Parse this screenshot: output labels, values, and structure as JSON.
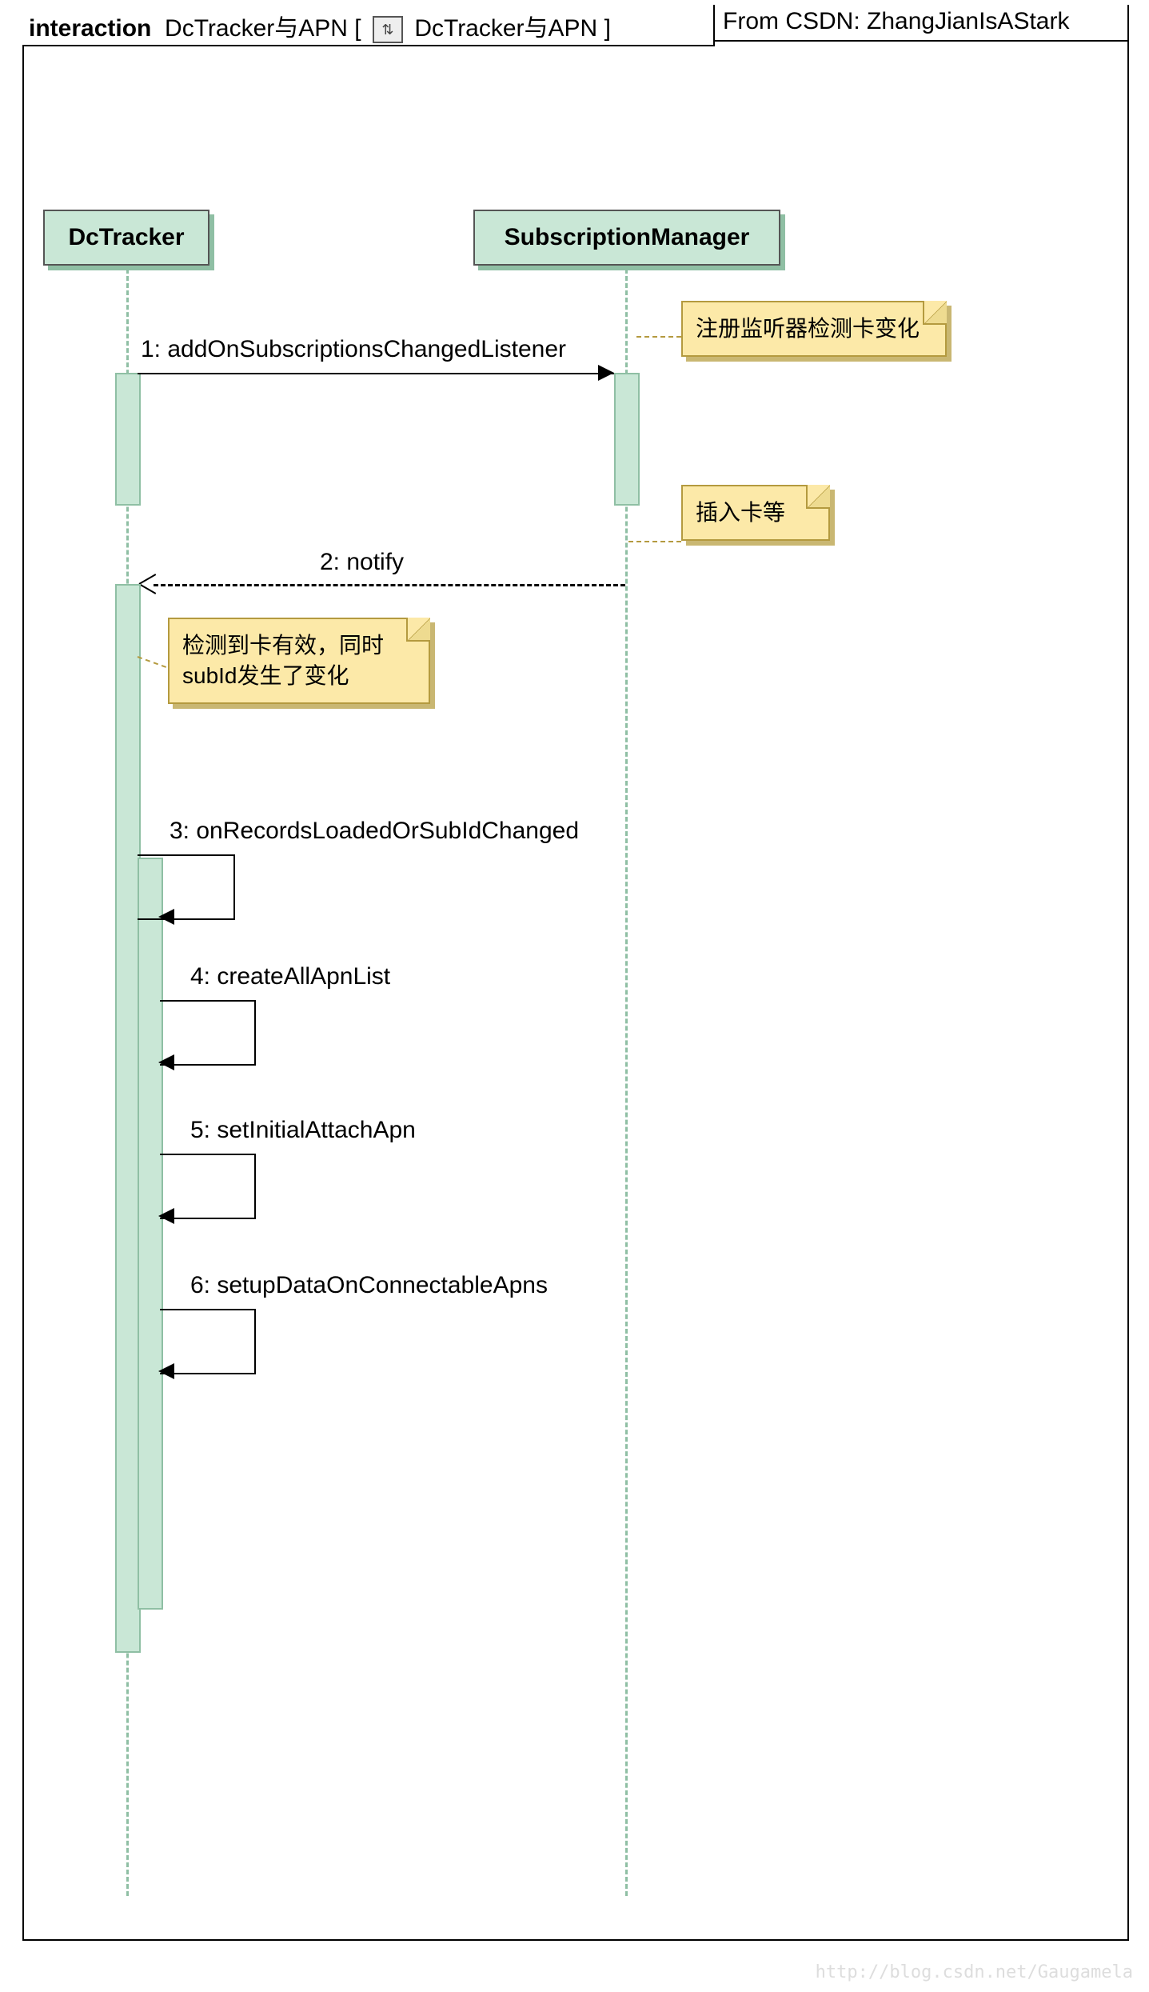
{
  "header": {
    "prefix": "interaction",
    "title": "DcTracker与APN",
    "inner_title": "DcTracker与APN",
    "reference": "From CSDN: ZhangJianIsAStark"
  },
  "lifelines": {
    "a": "DcTracker",
    "b": "SubscriptionManager"
  },
  "messages": {
    "m1": "1: addOnSubscriptionsChangedListener",
    "m2": "2: notify",
    "m3": "3: onRecordsLoadedOrSubIdChanged",
    "m4": "4: createAllApnList",
    "m5": "5: setInitialAttachApn",
    "m6": "6: setupDataOnConnectableApns"
  },
  "notes": {
    "n1": "注册监听器检测卡变化",
    "n2": "插入卡等",
    "n3": "检测到卡有效，同时subId发生了变化"
  },
  "watermark": "http://blog.csdn.net/Gaugamela",
  "colors": {
    "lifeline_fill": "#c9e7d6",
    "lifeline_border": "#8fbfa4",
    "note_fill": "#fce9a8",
    "note_border": "#b49a3f"
  },
  "chart_data": {
    "type": "sequence_diagram",
    "title": "interaction DcTracker与APN",
    "participants": [
      "DcTracker",
      "SubscriptionManager"
    ],
    "messages": [
      {
        "seq": 1,
        "from": "DcTracker",
        "to": "SubscriptionManager",
        "label": "addOnSubscriptionsChangedListener",
        "kind": "sync",
        "note": "注册监听器检测卡变化"
      },
      {
        "seq": 2,
        "from": "SubscriptionManager",
        "to": "DcTracker",
        "label": "notify",
        "kind": "reply",
        "note": "插入卡等"
      },
      {
        "seq": 3,
        "from": "DcTracker",
        "to": "DcTracker",
        "label": "onRecordsLoadedOrSubIdChanged",
        "kind": "self",
        "note": "检测到卡有效，同时subId发生了变化"
      },
      {
        "seq": 4,
        "from": "DcTracker",
        "to": "DcTracker",
        "label": "createAllApnList",
        "kind": "self"
      },
      {
        "seq": 5,
        "from": "DcTracker",
        "to": "DcTracker",
        "label": "setInitialAttachApn",
        "kind": "self"
      },
      {
        "seq": 6,
        "from": "DcTracker",
        "to": "DcTracker",
        "label": "setupDataOnConnectableApns",
        "kind": "self"
      }
    ]
  }
}
